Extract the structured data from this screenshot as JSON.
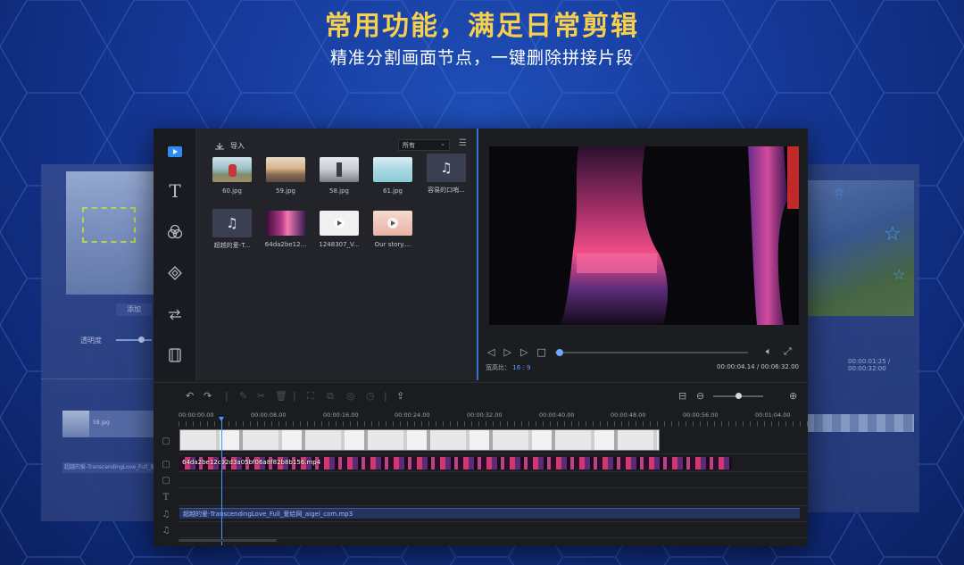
{
  "headline": "常用功能，满足日常剪辑",
  "subline": "精准分割画面节点，一键删除拼接片段",
  "ghost_left": {
    "button_label": "添加",
    "setting_label": "透明度",
    "audio_clip_label": "超越的爱-TranscendingLove_Full_爱给网_aigei_com.mp3",
    "video_clip_label": "58.jpg"
  },
  "ghost_right": {
    "timecode": "00:00:01:25 / 00:00:32:00"
  },
  "sidebar": {
    "items": [
      {
        "name": "media",
        "icon": "media-icon",
        "active": true
      },
      {
        "name": "text",
        "icon": "text-icon",
        "glyph": "T"
      },
      {
        "name": "filters",
        "icon": "filter-icon"
      },
      {
        "name": "overlays",
        "icon": "overlay-icon"
      },
      {
        "name": "transitions",
        "icon": "transition-icon"
      },
      {
        "name": "elements",
        "icon": "film-icon"
      }
    ]
  },
  "media": {
    "import_label": "导入",
    "filter_value": "所有",
    "items": [
      {
        "label": "60.jpg",
        "kind": "image"
      },
      {
        "label": "59.jpg",
        "kind": "image"
      },
      {
        "label": "58.jpg",
        "kind": "image"
      },
      {
        "label": "61.jpg",
        "kind": "image"
      },
      {
        "label": "容易的口哨...",
        "kind": "audio"
      },
      {
        "label": "超越的爱-T...",
        "kind": "audio"
      },
      {
        "label": "64da2be12...",
        "kind": "video"
      },
      {
        "label": "1248307_V...",
        "kind": "video"
      },
      {
        "label": "Our story....",
        "kind": "video"
      }
    ]
  },
  "preview": {
    "aspect_label": "宽高比：",
    "aspect_value": "16 : 9",
    "timecode": "00:00:04.14 / 00:06:32.00",
    "progress": 0.02
  },
  "timeline": {
    "ruler": [
      "00:00:00.00",
      "00:00:08.00",
      "00:00:16.00",
      "00:00:24.00",
      "00:00:32.00",
      "00:00:40.00",
      "00:00:48.00",
      "00:00:56.00",
      "00:01:04.00"
    ],
    "pip_clip_label": "64da2be12c92d3a05bf06a8f82b8b156.mp4",
    "audio_clip_label": "超越的爱-TranscendingLove_Full_爱给网_aigei_com.mp3",
    "zoom_level": 0.5
  },
  "colors": {
    "accent": "#2e8bf0",
    "headline": "#f6cf4e",
    "background": "#16399a"
  }
}
